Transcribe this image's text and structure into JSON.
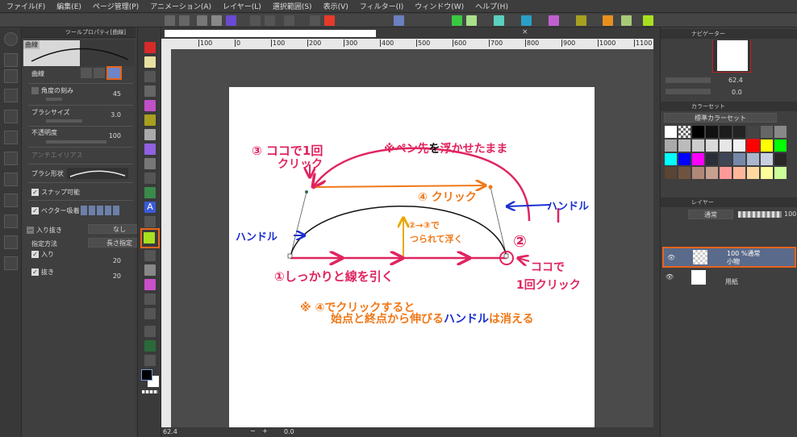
{
  "menu": [
    "ファイル(F)",
    "編集(E)",
    "ページ管理(P)",
    "アニメーション(A)",
    "レイヤー(L)",
    "選択範囲(S)",
    "表示(V)",
    "フィルター(I)",
    "ウィンドウ(W)",
    "ヘルプ(H)"
  ],
  "tool_property": {
    "tab_label": "ツールプロパティ[曲線]",
    "preview_label": "曲線",
    "curve_label": "曲線",
    "angle_step_label": "角度の刻み",
    "angle_step_value": "45",
    "brush_size_label": "ブラシサイズ",
    "brush_size_value": "3.0",
    "opacity_label": "不透明度",
    "opacity_value": "100",
    "antialias_label": "アンチエイリアス",
    "brush_shape_label": "ブラシ形状",
    "snap_label": "スナップ可能",
    "vector_snap_label": "ベクター吸着",
    "taper_label": "入り抜き",
    "taper_value": "なし",
    "method_label": "指定方法",
    "method_value": "長さ指定",
    "in_label": "入り",
    "in_value": "20",
    "out_label": "抜き",
    "out_value": "20",
    "snap_checked": true,
    "vector_snap_checked": true,
    "in_checked": true,
    "out_checked": true,
    "angle_step_checked": false
  },
  "ruler_ticks": [
    "100",
    "0",
    "100",
    "200",
    "300",
    "400",
    "500",
    "600",
    "700",
    "800",
    "900",
    "1000",
    "1100"
  ],
  "status": {
    "zoom": "62.4",
    "rotation": "0.0"
  },
  "canvas": {
    "note3_a": "③ ココで1回",
    "note3_b": "クリック",
    "float_a": "※ペン先",
    "float_b": "を",
    "float_c": "浮かせたまま",
    "click4": "④ クリック",
    "handle_left": "ハンドル",
    "handle_right": "ハンドル",
    "lift_a": "②→③で",
    "lift_b": "つられて浮く",
    "num2": "②",
    "step1": "①しっかりと線を引く",
    "click_here_a": "ココで",
    "click_here_b": "1回クリック",
    "footer_a": "※ ④でクリックすると",
    "footer_b1": "始点と終点から伸びる",
    "footer_b2": "ハンドル",
    "footer_b3": "は消える",
    "colors": {
      "pink": "#e0245e",
      "orange": "#f07818",
      "blue": "#1a2fd0",
      "yellow": "#e8a800"
    }
  },
  "navigator": {
    "tab_label": "ナビゲーター",
    "zoom": "62.4",
    "angle": "0.0"
  },
  "colorset": {
    "tab_label": "カラーセット",
    "set_name": "標準カラーセット",
    "swatches": [
      "#ffffff",
      "checker",
      "#000000",
      "#111111",
      "#1c1c1c",
      "#232323",
      "#444444",
      "#666666",
      "#888888",
      "#aaaaaa",
      "#bbbbbb",
      "#cccccc",
      "#d9d9d9",
      "#e6e6e6",
      "#f2f2f2",
      "#ff0000",
      "#ffff00",
      "#00ff00",
      "#00ffff",
      "#0000ff",
      "#ff00ff",
      "#2a2e38",
      "#3e4656",
      "#7689a9",
      "#aab6cc",
      "#c8d0e0",
      "#2a2826",
      "#5a4434",
      "#6e5440",
      "#b08878",
      "#c8a090",
      "#ff9999",
      "#ffb899",
      "#ffd8a0",
      "#ffff99",
      "#ccff99"
    ]
  },
  "layers": {
    "tab_label": "レイヤー",
    "blend_mode": "通常",
    "opacity": "100",
    "items": [
      {
        "info": "100 %通常",
        "name": "小物",
        "selected": true
      },
      {
        "info": "",
        "name": "用紙",
        "selected": false
      }
    ]
  },
  "accent": "#e8641e"
}
